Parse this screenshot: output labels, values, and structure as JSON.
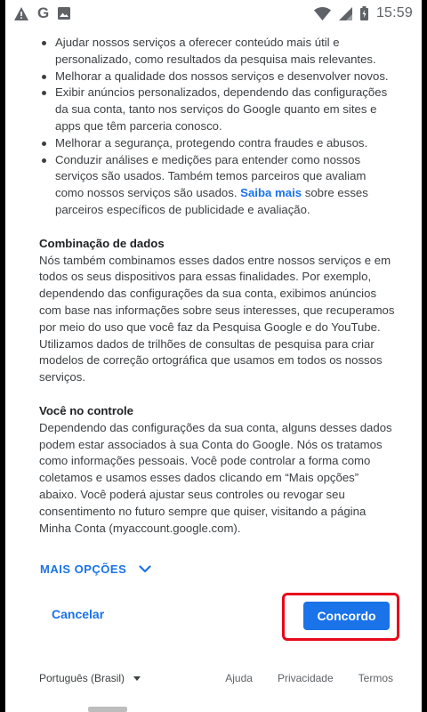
{
  "status_bar": {
    "time": "15:59",
    "icons": [
      "warning-icon",
      "google-g-icon",
      "image-icon",
      "wifi-icon",
      "signal-icon",
      "battery-icon"
    ],
    "g_letter": "G"
  },
  "bullets": [
    {
      "text": "Ajudar nossos serviços a oferecer conteúdo mais útil e personalizado, como resultados da pesquisa mais relevantes."
    },
    {
      "text": "Melhorar a qualidade dos nossos serviços e desenvolver novos."
    },
    {
      "text": "Exibir anúncios personalizados, dependendo das configurações da sua conta, tanto nos serviços do Google quanto em sites e apps que têm parceria conosco."
    },
    {
      "text": "Melhorar a segurança, protegendo contra fraudes e abusos."
    },
    {
      "text_before": "Conduzir análises e medições para entender como nossos serviços são usados. Também temos parceiros que avaliam como nossos serviços são usados. ",
      "link": "Saiba mais",
      "text_after": " sobre esses parceiros específicos de publicidade e avaliação."
    }
  ],
  "sections": [
    {
      "title": "Combinação de dados",
      "body": "Nós também combinamos esses dados entre nossos serviços e em todos os seus dispositivos para essas finalidades. Por exemplo, dependendo das configurações da sua conta, exibimos anúncios com base nas informações sobre seus interesses, que recuperamos por meio do uso que você faz da Pesquisa Google e do YouTube. Utilizamos dados de trilhões de consultas de pesquisa para criar modelos de correção ortográfica que usamos em todos os nossos serviços."
    },
    {
      "title": "Você no controle",
      "body": "Dependendo das configurações da sua conta, alguns desses dados podem estar associados à sua Conta do Google. Nós os tratamos como informações pessoais. Você pode controlar a forma como coletamos e usamos esses dados clicando em “Mais opções” abaixo. Você poderá ajustar seus controles ou revogar seu consentimento no futuro sempre que quiser, visitando a página Minha Conta (myaccount.google.com)."
    }
  ],
  "more_options_label": "MAIS OPÇÕES",
  "cancel_label": "Cancelar",
  "agree_label": "Concordo",
  "footer": {
    "language": "Português (Brasil)",
    "help": "Ajuda",
    "privacy": "Privacidade",
    "terms": "Termos"
  },
  "colors": {
    "accent": "#1a73e8",
    "highlight": "#e8071b",
    "text": "#3c4043"
  }
}
